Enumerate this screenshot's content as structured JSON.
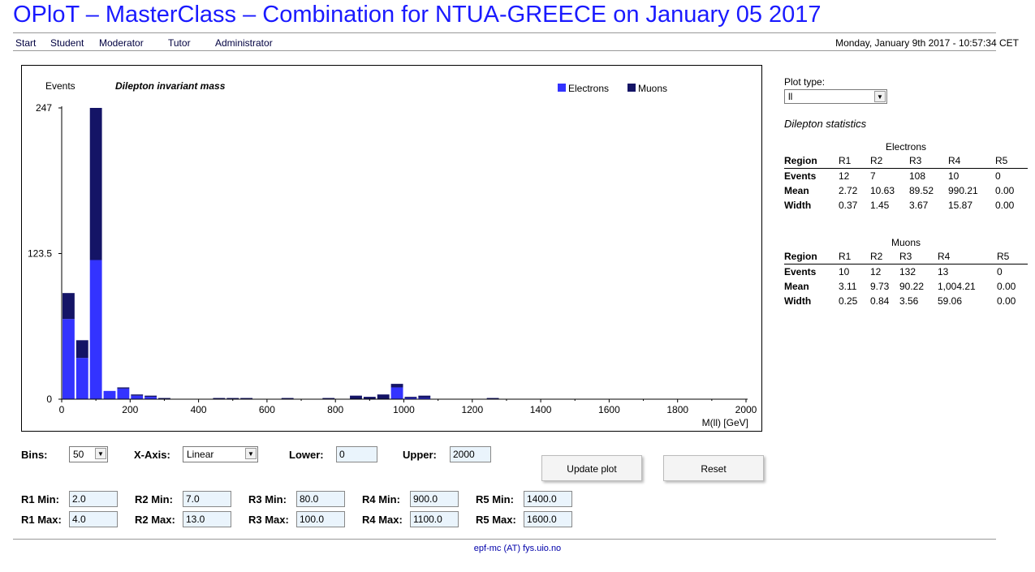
{
  "header": {
    "title": "OPloT – MasterClass – Combination for NTUA-GREECE on January 05 2017",
    "datetime": "Monday, January 9th 2017 - 10:57:34 CET"
  },
  "nav": [
    "Start",
    "Student",
    "Moderator",
    "Tutor",
    "Administrator"
  ],
  "chart_data": {
    "type": "bar",
    "stacked": true,
    "title": "Dilepton invariant mass",
    "ylabel": "Events",
    "xlabel": "M(ll) [GeV]",
    "xlim": [
      0,
      2000
    ],
    "ylim": [
      0,
      247
    ],
    "yticks": [
      "0",
      "123.5",
      "247"
    ],
    "xticks": [
      "0",
      "200",
      "400",
      "600",
      "800",
      "1000",
      "1200",
      "1400",
      "1600",
      "1800",
      "2000"
    ],
    "legend": "top-right",
    "bin_width": 40,
    "colors": {
      "Electrons": "#3333ff",
      "Muons": "#141466"
    },
    "series": [
      {
        "name": "Electrons",
        "values": [
          68,
          35,
          118,
          7,
          9,
          3,
          2,
          0,
          0,
          0,
          0,
          0,
          0,
          0,
          0,
          0,
          0,
          0,
          0,
          0,
          0,
          0,
          0,
          0,
          10,
          1,
          1,
          0,
          0,
          0,
          0,
          0,
          0,
          0,
          0,
          0,
          0,
          0,
          0,
          0,
          0,
          0,
          0,
          0,
          0,
          0,
          0,
          0,
          0,
          0
        ]
      },
      {
        "name": "Muons",
        "values": [
          22,
          15,
          129,
          0,
          1,
          1,
          1,
          1,
          0,
          0,
          0,
          1,
          1,
          1,
          0,
          0,
          1,
          0,
          0,
          1,
          0,
          3,
          2,
          4,
          3,
          1,
          2,
          0,
          0,
          0,
          0,
          1,
          0,
          0,
          0,
          0,
          0,
          0,
          0,
          0,
          0,
          0,
          0,
          0,
          0,
          0,
          0,
          0,
          0,
          0
        ]
      }
    ]
  },
  "sidebar": {
    "plot_type_label": "Plot type:",
    "plot_type_value": "ll",
    "stats_title": "Dilepton statistics",
    "electrons": {
      "caption": "Electrons",
      "header": [
        "Region",
        "R1",
        "R2",
        "R3",
        "R4",
        "R5"
      ],
      "rows": [
        [
          "Events",
          "12",
          "7",
          "108",
          "10",
          "0"
        ],
        [
          "Mean",
          "2.72",
          "10.63",
          "89.52",
          "990.21",
          "0.00"
        ],
        [
          "Width",
          "0.37",
          "1.45",
          "3.67",
          "15.87",
          "0.00"
        ]
      ]
    },
    "muons": {
      "caption": "Muons",
      "header": [
        "Region",
        "R1",
        "R2",
        "R3",
        "R4",
        "R5"
      ],
      "rows": [
        [
          "Events",
          "10",
          "12",
          "132",
          "13",
          "0"
        ],
        [
          "Mean",
          "3.11",
          "9.73",
          "90.22",
          "1,004.21",
          "0.00"
        ],
        [
          "Width",
          "0.25",
          "0.84",
          "3.56",
          "59.06",
          "0.00"
        ]
      ]
    }
  },
  "controls": {
    "bins_label": "Bins:",
    "bins_value": "50",
    "xaxis_label": "X-Axis:",
    "xaxis_value": "Linear",
    "lower_label": "Lower:",
    "lower_value": "0",
    "upper_label": "Upper:",
    "upper_value": "2000",
    "update_button": "Update plot",
    "reset_button": "Reset",
    "regions": [
      {
        "min_label": "R1 Min:",
        "min": "2.0",
        "max_label": "R1 Max:",
        "max": "4.0"
      },
      {
        "min_label": "R2 Min:",
        "min": "7.0",
        "max_label": "R2 Max:",
        "max": "13.0"
      },
      {
        "min_label": "R3 Min:",
        "min": "80.0",
        "max_label": "R3 Max:",
        "max": "100.0"
      },
      {
        "min_label": "R4 Min:",
        "min": "900.0",
        "max_label": "R4 Max:",
        "max": "1100.0"
      },
      {
        "min_label": "R5 Min:",
        "min": "1400.0",
        "max_label": "R5 Max:",
        "max": "1600.0"
      }
    ]
  },
  "footer": "epf-mc (AT) fys.uio.no"
}
